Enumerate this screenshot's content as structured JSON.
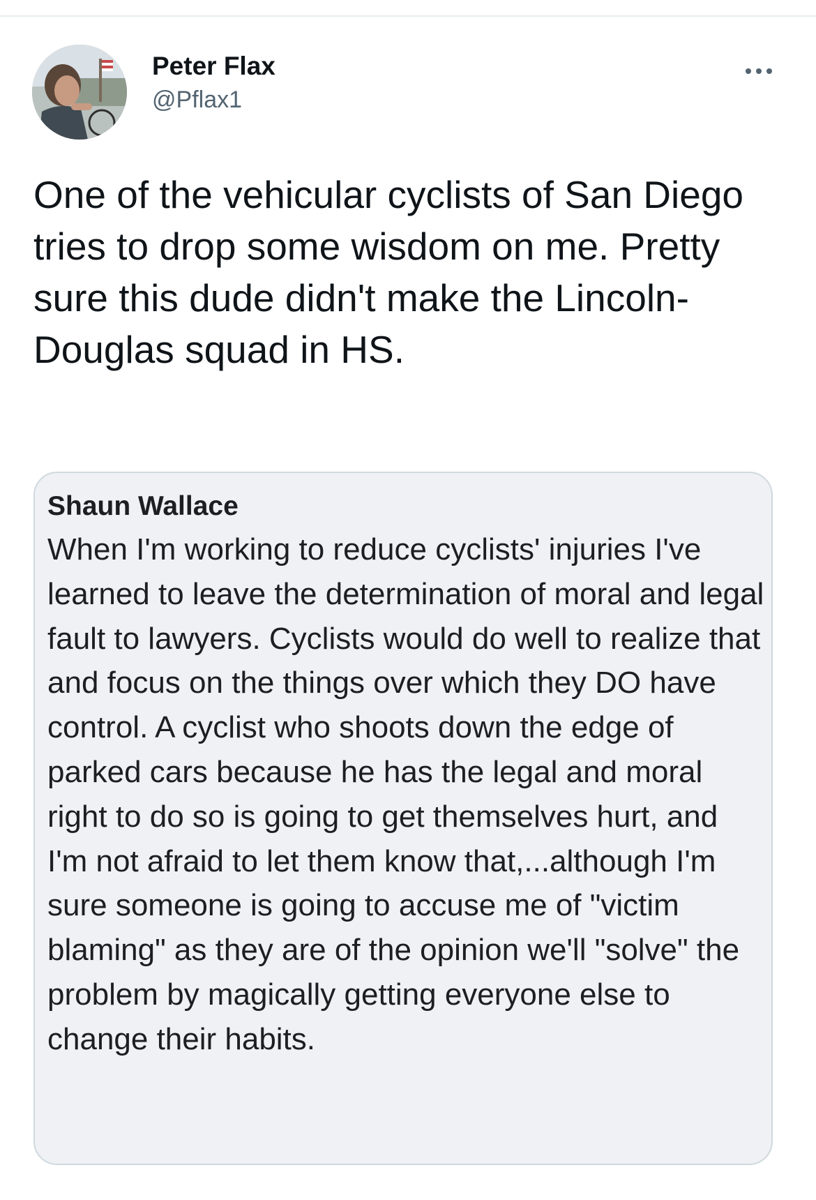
{
  "tweet": {
    "author": {
      "name": "Peter Flax",
      "handle": "@Pflax1",
      "avatar_icon": "profile-photo"
    },
    "more_icon": "more-options-icon",
    "text": "One of the vehicular cyclists of San Diego tries to drop some wisdom on me. Pretty sure this dude didn't make the Lincoln-Douglas squad in HS.",
    "quoted": {
      "author": "Shaun Wallace",
      "text": "When I'm working to reduce cyclists' injuries I've learned to leave the determination of moral and legal fault to lawyers. Cyclists would do well to realize that and focus on the things over which they DO have control. A cyclist who shoots down the edge of parked cars because he has the legal and moral right to do so is going to get themselves hurt, and I'm not afraid to let them know that,...although I'm sure someone is going to accuse me of \"victim blaming\" as they are of the opinion we'll \"solve\" the problem by magically getting everyone else to change their habits."
    }
  },
  "colors": {
    "text_primary": "#0f1419",
    "text_secondary": "#536471",
    "quote_background": "#eff1f5",
    "quote_border": "#cfd9de"
  }
}
